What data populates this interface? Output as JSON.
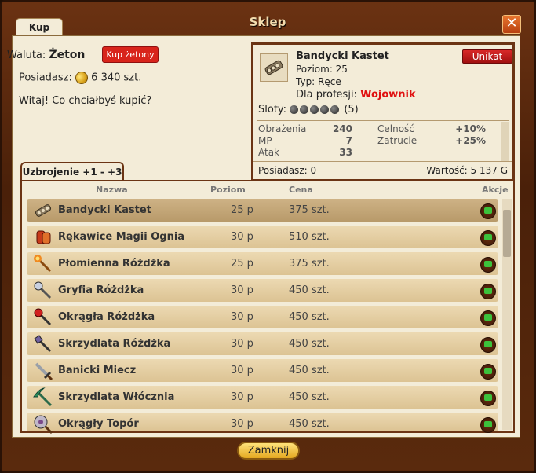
{
  "window": {
    "title": "Sklep",
    "close_label": "✕"
  },
  "tabs": {
    "kup": "Kup"
  },
  "currency": {
    "label": "Waluta:",
    "name": "Żeton",
    "buy_button": "Kup żetony"
  },
  "owned": {
    "label": "Posiadasz:",
    "amount": "6 340 szt."
  },
  "greeting": "Witaj! Co chciałbyś kupić?",
  "tooltip": {
    "name": "Bandycki Kastet",
    "rarity": "Unikat",
    "level_line": "Poziom: 25",
    "type_line": "Typ: Ręce",
    "profession_label": "Dla profesji:",
    "profession": "Wojownik",
    "slots_label": "Sloty:",
    "slots_count": "(5)",
    "stats": [
      {
        "label": "Obrażenia",
        "value": "240"
      },
      {
        "label": "MP",
        "value": "7"
      },
      {
        "label": "Atak",
        "value": "33"
      }
    ],
    "stats2": [
      {
        "label": "Celność",
        "value": "+10%"
      },
      {
        "label": "Zatrucie",
        "value": "+25%"
      }
    ],
    "owned_label": "Posiadasz: 0",
    "value_label": "Wartość: 5 137 G"
  },
  "category_tab": "Uzbrojenie +1 - +3",
  "columns": {
    "name": "Nazwa",
    "level": "Poziom",
    "price": "Cena",
    "actions": "Akcje"
  },
  "items": [
    {
      "name": "Bandycki Kastet",
      "level": "25 p",
      "price": "375 szt."
    },
    {
      "name": "Rękawice Magii Ognia",
      "level": "30 p",
      "price": "510 szt."
    },
    {
      "name": "Płomienna Różdżka",
      "level": "25 p",
      "price": "375 szt."
    },
    {
      "name": "Gryfia Różdżka",
      "level": "30 p",
      "price": "450 szt."
    },
    {
      "name": "Okrągła Różdżka",
      "level": "30 p",
      "price": "450 szt."
    },
    {
      "name": "Skrzydlata Różdżka",
      "level": "30 p",
      "price": "450 szt."
    },
    {
      "name": "Banicki Miecz",
      "level": "30 p",
      "price": "450 szt."
    },
    {
      "name": "Skrzydlata Włócznia",
      "level": "30 p",
      "price": "450 szt."
    },
    {
      "name": "Okrągły Topór",
      "level": "30 p",
      "price": "450 szt."
    }
  ],
  "footer": {
    "close_button": "Zamknij"
  }
}
